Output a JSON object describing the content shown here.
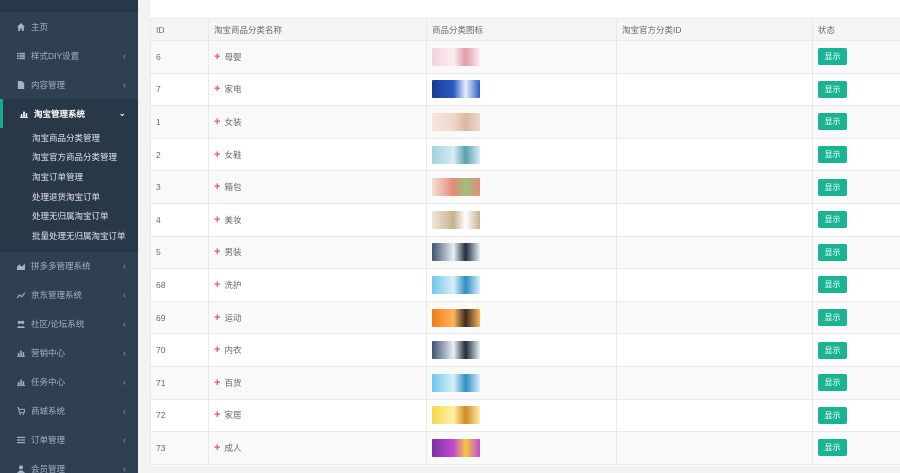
{
  "sidebar": {
    "items_top": [
      {
        "label": "主页",
        "icon": "home-icon",
        "chevron": ""
      },
      {
        "label": "样式DIY设置",
        "icon": "list-icon",
        "chevron": "‹"
      },
      {
        "label": "内容管理",
        "icon": "file-icon",
        "chevron": "‹"
      }
    ],
    "active": {
      "label": "淘宝管理系统",
      "icon": "bar-chart-icon",
      "chevron": "⌄"
    },
    "subitems": [
      "淘宝商品分类管理",
      "淘宝官方商品分类管理",
      "淘宝订单管理",
      "处理退货淘宝订单",
      "处理无归属淘宝订单",
      "批量处理无归属淘宝订单"
    ],
    "items_bottom": [
      {
        "label": "拼多多管理系统",
        "icon": "area-chart-icon",
        "chevron": "‹"
      },
      {
        "label": "京东管理系统",
        "icon": "line-chart-icon",
        "chevron": "‹"
      },
      {
        "label": "社区/论坛系统",
        "icon": "users-icon",
        "chevron": "‹"
      },
      {
        "label": "营销中心",
        "icon": "bar-chart-icon",
        "chevron": "‹"
      },
      {
        "label": "任务中心",
        "icon": "bar-chart-icon",
        "chevron": "‹"
      },
      {
        "label": "商城系统",
        "icon": "cart-icon",
        "chevron": "‹"
      },
      {
        "label": "订单管理",
        "icon": "menu-icon",
        "chevron": "‹"
      },
      {
        "label": "会员管理",
        "icon": "user-icon",
        "chevron": "‹"
      }
    ]
  },
  "table": {
    "headers": {
      "id": "ID",
      "name": "淘宝商品分类名称",
      "icon": "商品分类图标",
      "official_id": "淘宝官方分类ID",
      "status": "状态"
    },
    "rows": [
      {
        "id": "6",
        "name": "母婴",
        "official_id": "",
        "status": "显示",
        "thumb": [
          "#f4d3dc",
          "#fbeef1",
          "#e39aa8"
        ]
      },
      {
        "id": "7",
        "name": "家电",
        "official_id": "",
        "status": "显示",
        "thumb": [
          "#1a3c8e",
          "#2a5bc8",
          "#e8eef8"
        ]
      },
      {
        "id": "1",
        "name": "女装",
        "official_id": "",
        "status": "显示",
        "thumb": [
          "#f7e4e0",
          "#f1d7c9",
          "#d9b8a0"
        ]
      },
      {
        "id": "2",
        "name": "女鞋",
        "official_id": "",
        "status": "显示",
        "thumb": [
          "#9fd3e0",
          "#d8edf2",
          "#5a9fb3"
        ]
      },
      {
        "id": "3",
        "name": "箱包",
        "official_id": "",
        "status": "显示",
        "thumb": [
          "#f3e0d2",
          "#e58a7a",
          "#9bc27a"
        ]
      },
      {
        "id": "4",
        "name": "美妆",
        "official_id": "",
        "status": "显示",
        "thumb": [
          "#efe6d8",
          "#c9b18f",
          "#ffffff"
        ]
      },
      {
        "id": "5",
        "name": "男装",
        "official_id": "",
        "status": "显示",
        "thumb": [
          "#3f5470",
          "#e9eef4",
          "#1f2d40"
        ]
      },
      {
        "id": "68",
        "name": "洗护",
        "official_id": "",
        "status": "显示",
        "thumb": [
          "#6fc6ea",
          "#d7f0fb",
          "#2c8fc4"
        ]
      },
      {
        "id": "69",
        "name": "运动",
        "official_id": "",
        "status": "显示",
        "thumb": [
          "#f07b1a",
          "#ffb45a",
          "#3a2c20"
        ]
      },
      {
        "id": "70",
        "name": "内衣",
        "official_id": "",
        "status": "显示",
        "thumb": [
          "#3f5470",
          "#e9eef4",
          "#1f2d40"
        ]
      },
      {
        "id": "71",
        "name": "百货",
        "official_id": "",
        "status": "显示",
        "thumb": [
          "#6fc6ea",
          "#d7f0fb",
          "#2c8fc4"
        ]
      },
      {
        "id": "72",
        "name": "家居",
        "official_id": "",
        "status": "显示",
        "thumb": [
          "#f6d64a",
          "#fff1a8",
          "#d18b1f"
        ]
      },
      {
        "id": "73",
        "name": "成人",
        "official_id": "",
        "status": "显示",
        "thumb": [
          "#7b2fa5",
          "#c54ad0",
          "#f4c93c"
        ]
      }
    ]
  },
  "colors": {
    "sidebar_bg": "#2f4050",
    "accent": "#1ab394",
    "plus": "#ed5565"
  }
}
